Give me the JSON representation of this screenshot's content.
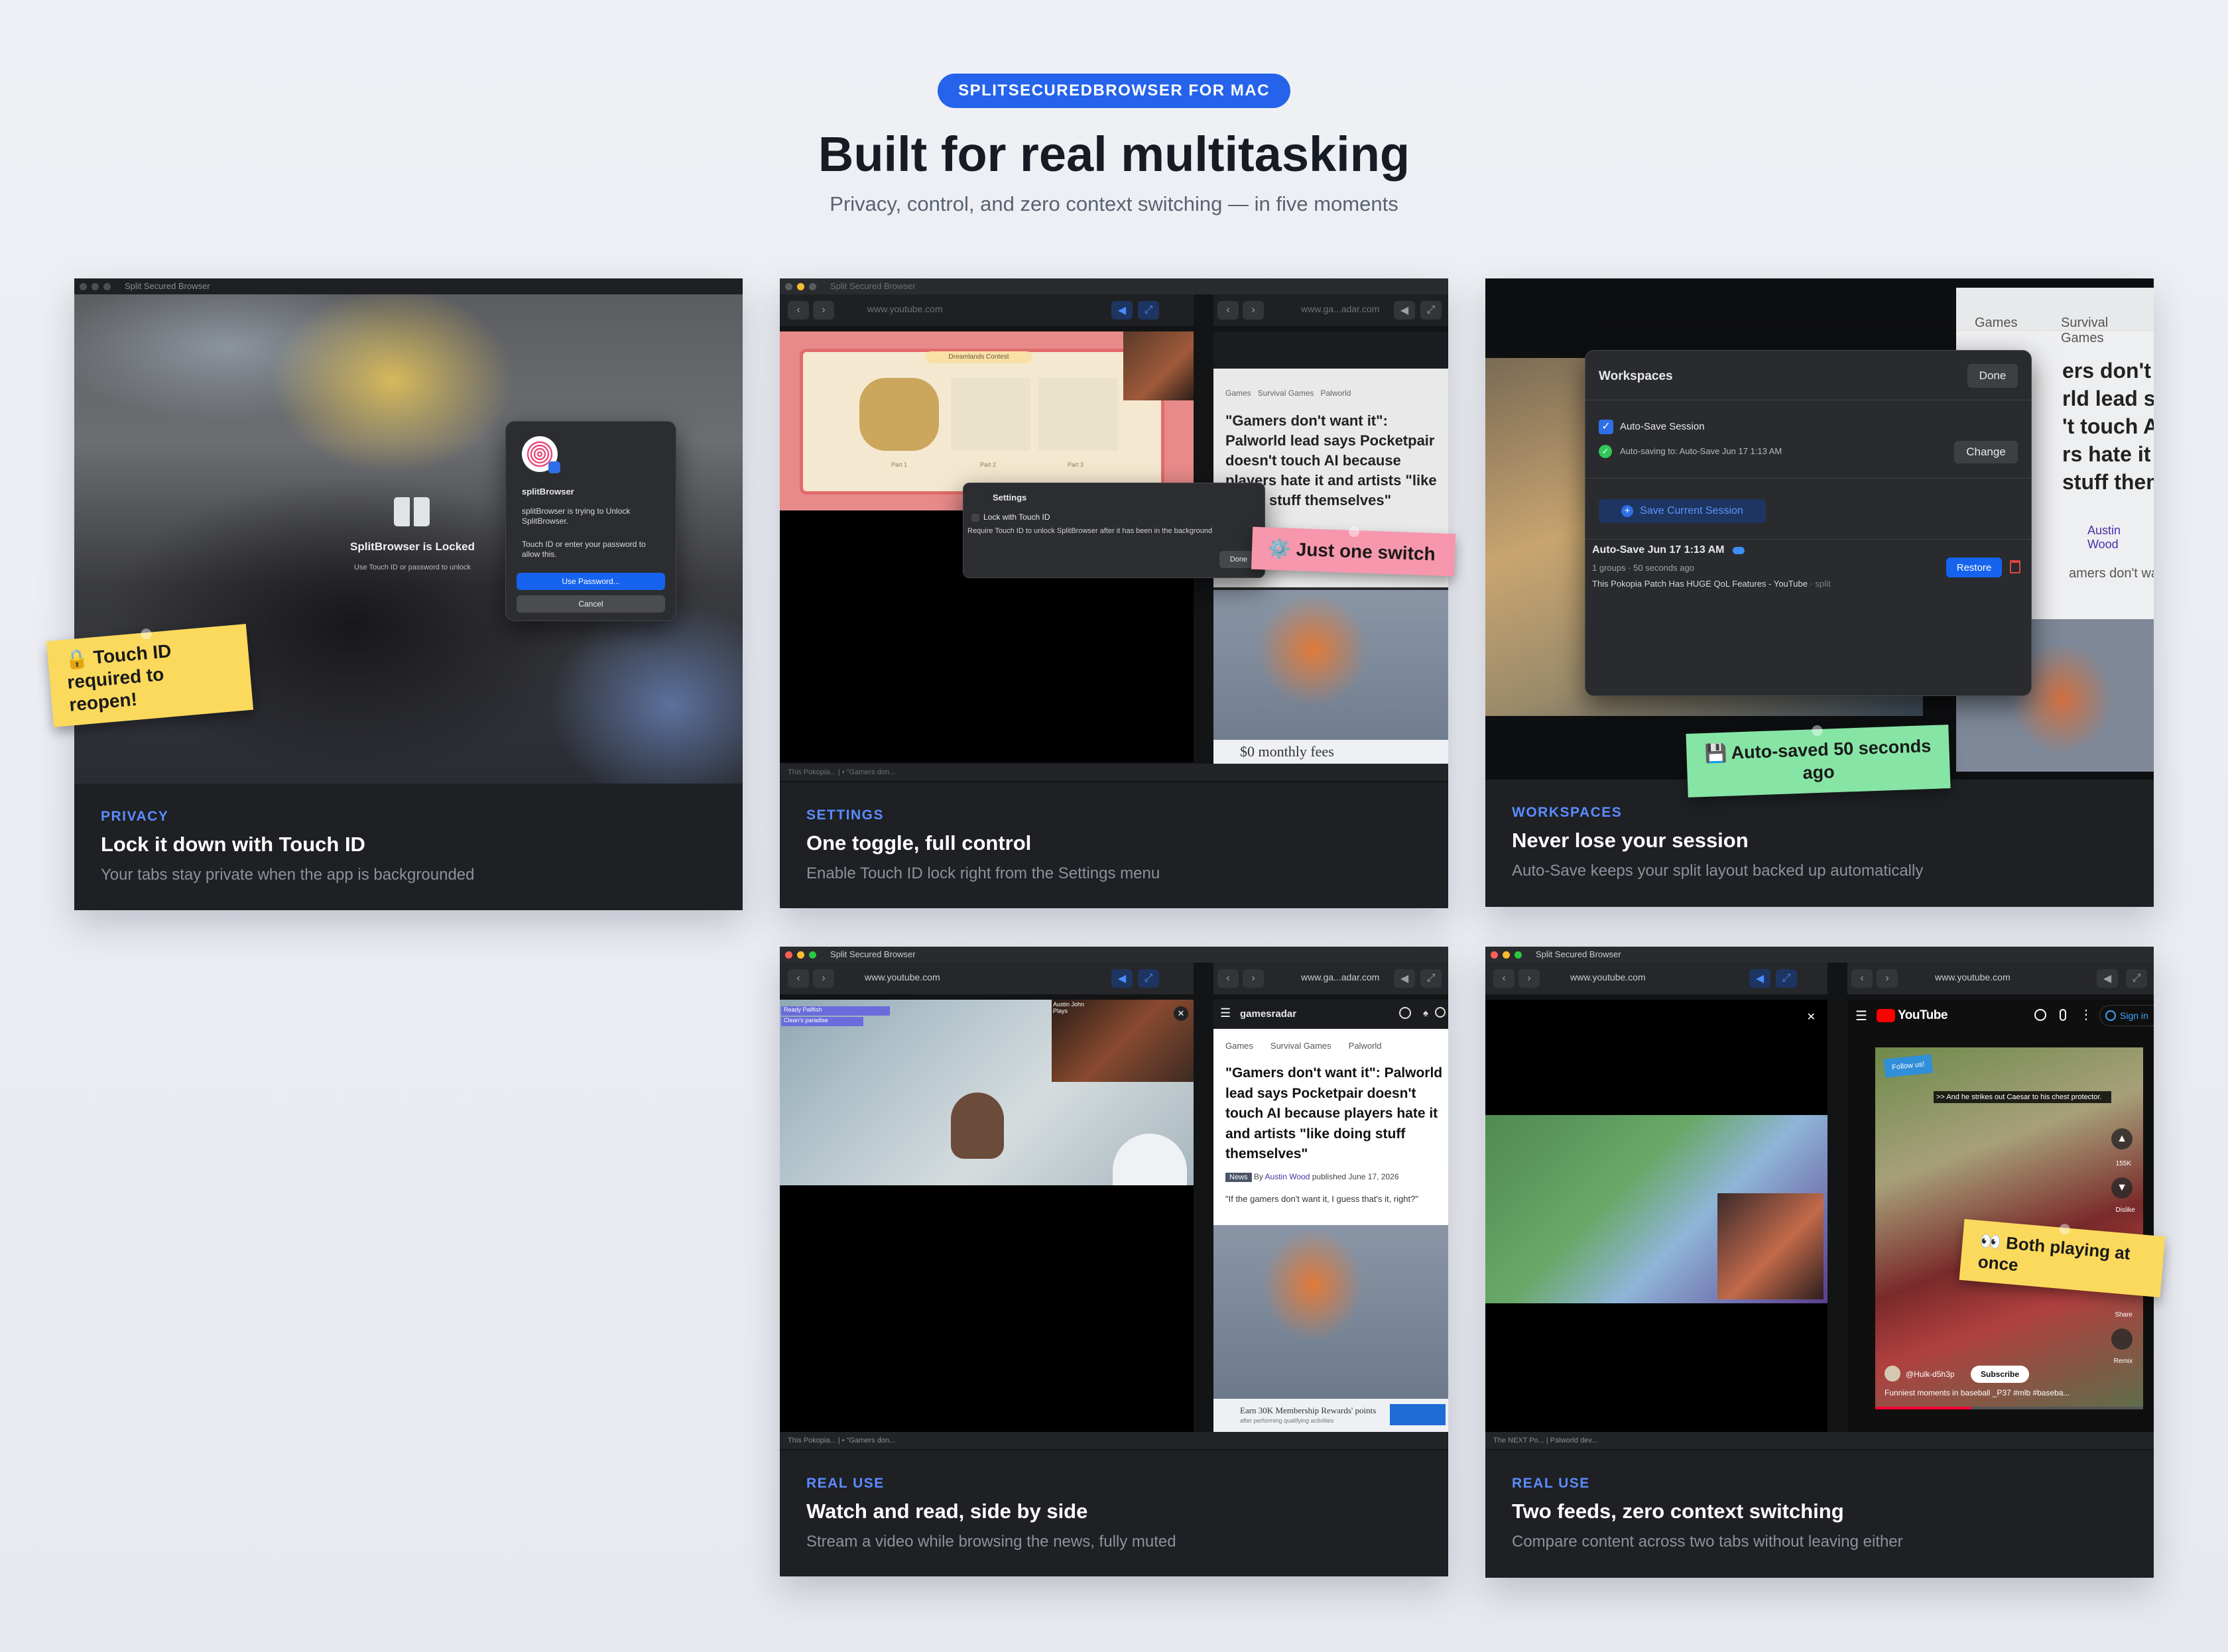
{
  "header": {
    "badge": "SPLITSECUREDBROWSER FOR MAC",
    "title": "Built for real multitasking",
    "subtitle": "Privacy, control, and zero context switching — in five moments"
  },
  "app": {
    "window_title": "Split Secured Browser"
  },
  "cards": [
    {
      "category": "PRIVACY",
      "title": "Lock it down with Touch ID",
      "description": "Your tabs stay private when the app is backgrounded",
      "sticky": "🔒 Touch ID\nrequired to reopen!",
      "lock": {
        "title": "SplitBrowser is Locked",
        "hint": "Use Touch ID or password to unlock"
      },
      "dialog": {
        "app_name": "splitBrowser",
        "message": "splitBrowser is trying to Unlock SplitBrowser.",
        "prompt": "Touch ID or enter your password to allow this.",
        "primary": "Use Password...",
        "cancel": "Cancel"
      }
    },
    {
      "category": "SETTINGS",
      "title": "One toggle, full control",
      "description": "Enable Touch ID lock right from the Settings menu",
      "sticky": "⚙️ Just one switch",
      "left_url": "www.youtube.com",
      "right_url": "www.ga...adar.com",
      "settings": {
        "title": "Settings",
        "toggle": "Lock with Touch ID",
        "desc": "Require Touch ID to unlock SplitBrowser after it has been in the background",
        "done": "Done"
      },
      "game_sign": "Dreamlands Contest",
      "part_labels": [
        "Part 1",
        "Part 2",
        "Part 3"
      ],
      "ad_text": "$0 monthly fees",
      "status_tabs": "This Pokopia... | • \"Gamers don..."
    },
    {
      "category": "WORKSPACES",
      "title": "Never lose your session",
      "description": "Auto-Save keeps your split layout backed up automatically",
      "sticky": "💾 Auto-saved 50 seconds\nago",
      "bg_crumbs": [
        "Games",
        "Survival Games"
      ],
      "bg_headline": [
        "ers don't wa",
        "rld lead say",
        "'t touch AI b",
        "rs hate it an",
        "stuff thems"
      ],
      "bg_author": "Austin Wood",
      "bg_line": "amers don't want i",
      "workspaces": {
        "title": "Workspaces",
        "done": "Done",
        "autosave_label": "Auto-Save Session",
        "autosave_status": "Auto-saving to: Auto-Save Jun 17 1:13 AM",
        "change": "Change",
        "save_button": "Save Current Session",
        "session_name": "Auto-Save Jun 17 1:13 AM",
        "session_meta": "1 groups · 50 seconds ago",
        "session_page": "This Pokopia Patch Has HUGE QoL Features - YouTube",
        "session_tag": "· split",
        "restore": "Restore"
      }
    },
    {
      "category": "REAL USE",
      "title": "Watch and read, side by side",
      "description": "Stream a video while browsing the news, fully muted",
      "left_url": "www.youtube.com",
      "right_url": "www.ga...adar.com",
      "site_name": "gamesradar",
      "crumbs": [
        "Games",
        "Survival Games",
        "Palworld"
      ],
      "headline": "\"Gamers don't want it\": Palworld lead says Pocketpair doesn't touch AI because players hate it and artists \"like doing stuff themselves\"",
      "tag": "News",
      "byline_prefix": "By",
      "author": "Austin Wood",
      "date": "published June 17, 2026",
      "quote": "\"If the gamers don't want it, I guess that's it, right?\"",
      "chat": [
        "Ready Pallfish",
        "Clean's paradise"
      ],
      "cam_label": "Austin John Plays",
      "ad_text": "Earn 30K Membership Rewards' points",
      "ad_sub": "after performing qualifying activities",
      "status_tabs": "This Pokopia... | • \"Gamers don..."
    },
    {
      "category": "REAL USE",
      "title": "Two feeds, zero context switching",
      "description": "Compare content across two tabs without leaving either",
      "sticky": "👀 Both playing at\nonce",
      "left_url": "www.youtube.com",
      "right_url": "www.youtube.com",
      "yt_brand": "YouTube",
      "sign_in": "Sign in",
      "caption": ">> And he strikes out Caesar to his chest protector.",
      "likes": "155K",
      "dislike": "Dislike",
      "share": "Share",
      "remix": "Remix",
      "channel": "@Hulk-d5h3p",
      "subscribe": "Subscribe",
      "short_title": "Funniest moments in baseball _P37 #mlb #baseba...",
      "follow": "Follow us!",
      "status_tabs": "The NEXT Po... | Palworld dev..."
    }
  ]
}
